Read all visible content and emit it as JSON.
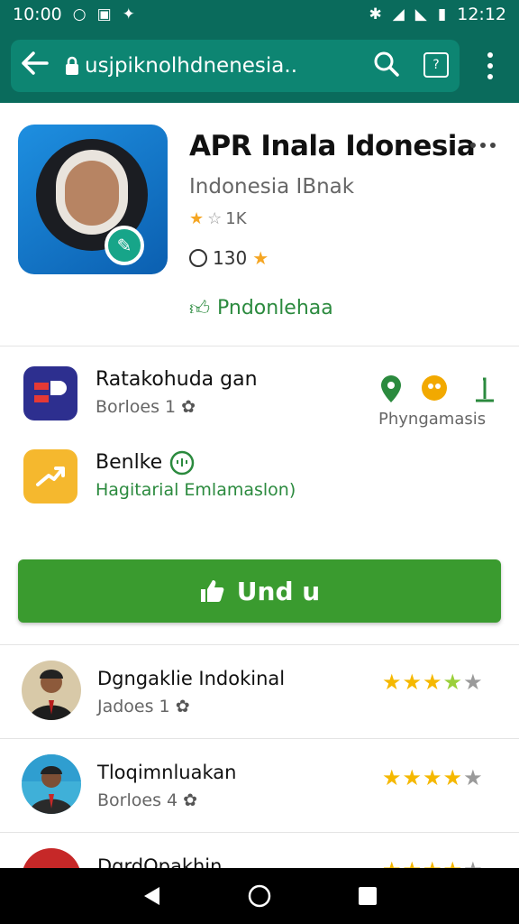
{
  "status_bar": {
    "time_left": "10:00",
    "time_right": "12:12"
  },
  "url_bar": {
    "url": "usjpiknolhdnenesia..",
    "tab_count": "?"
  },
  "app": {
    "title": "APR Inala Idonesia",
    "developer": "Indonesia IBnak",
    "rating": "1K",
    "downloads": "130",
    "link_label": "Pndonlehaa"
  },
  "related": [
    {
      "name": "Ratakohuda gan",
      "sub": "Borloes 1"
    },
    {
      "name": "Benlke",
      "sub": "Hagitarial Emlamaslon)"
    }
  ],
  "meta_label": "Phyngamasis",
  "install": {
    "label": "Und u"
  },
  "reviews": [
    {
      "name": "Dgngaklie Indokinal",
      "sub": "Jadoes 1",
      "stars": 4.5
    },
    {
      "name": "Tloqimnluakan",
      "sub": "Borloes 4",
      "stars": 4
    },
    {
      "name": "DgrdOpakhin",
      "sub": "",
      "stars": 4
    }
  ],
  "colors": {
    "toolbar": "#0a6b5c",
    "install": "#3a9b2f",
    "star": "#f5b800"
  }
}
